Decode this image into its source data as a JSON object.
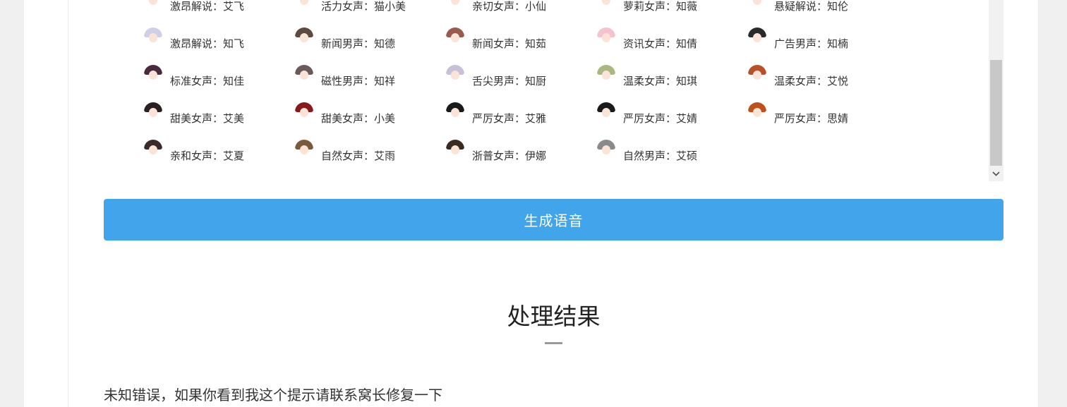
{
  "voices": [
    {
      "label": "激昂解说：艾飞",
      "icon": "avatar-icon",
      "hair": "#b8a8d8"
    },
    {
      "label": "活力女声：猫小美",
      "icon": "avatar-icon",
      "hair": "#d9b08c"
    },
    {
      "label": "亲切女声：小仙",
      "icon": "avatar-icon",
      "hair": "#e6c8e0"
    },
    {
      "label": "萝莉女声：知薇",
      "icon": "avatar-icon",
      "hair": "#6b4a3a"
    },
    {
      "label": "悬疑解说：知伦",
      "icon": "avatar-icon",
      "hair": "#1a1a1a"
    },
    {
      "label": "激昂解说：知飞",
      "icon": "avatar-icon",
      "hair": "#cfd0e8"
    },
    {
      "label": "新闻男声：知德",
      "icon": "avatar-icon",
      "hair": "#5a4a40"
    },
    {
      "label": "新闻女声：知茹",
      "icon": "avatar-icon",
      "hair": "#9a5a50"
    },
    {
      "label": "资讯女声：知倩",
      "icon": "avatar-icon",
      "hair": "#f3c4d0"
    },
    {
      "label": "广告男声：知楠",
      "icon": "avatar-icon",
      "hair": "#2a2a2a"
    },
    {
      "label": "标准女声：知佳",
      "icon": "avatar-icon",
      "hair": "#4a2a40"
    },
    {
      "label": "磁性男声：知祥",
      "icon": "avatar-icon",
      "hair": "#6a5a5a"
    },
    {
      "label": "舌尖男声：知厨",
      "icon": "avatar-icon",
      "hair": "#c8c0d8"
    },
    {
      "label": "温柔女声：知琪",
      "icon": "avatar-icon",
      "hair": "#a8b880"
    },
    {
      "label": "温柔女声：艾悦",
      "icon": "avatar-icon",
      "hair": "#b8502a"
    },
    {
      "label": "甜美女声：艾美",
      "icon": "avatar-icon",
      "hair": "#2a2020"
    },
    {
      "label": "甜美女声：小美",
      "icon": "avatar-icon",
      "hair": "#8a1a1a"
    },
    {
      "label": "严厉女声：艾雅",
      "icon": "avatar-icon",
      "hair": "#1a1a1a"
    },
    {
      "label": "严厉女声：艾婧",
      "icon": "avatar-icon",
      "hair": "#1a1a1a"
    },
    {
      "label": "严厉女声：思婧",
      "icon": "avatar-icon",
      "hair": "#c0501a"
    },
    {
      "label": "亲和女声：艾夏",
      "icon": "avatar-icon",
      "hair": "#3a2a2a"
    },
    {
      "label": "自然女声：艾雨",
      "icon": "avatar-icon",
      "hair": "#7a5a3a"
    },
    {
      "label": "浙普女声：伊娜",
      "icon": "avatar-icon",
      "hair": "#3a2a20"
    },
    {
      "label": "自然男声：艾硕",
      "icon": "avatar-icon",
      "hair": "#8a8a8a"
    }
  ],
  "generate_label": "生成语音",
  "result": {
    "title": "处理结果",
    "message": "未知错误，如果你看到我这个提示请联系窝长修复一下"
  },
  "colors": {
    "accent": "#42a5ec",
    "page_bg": "#f0f0f0"
  }
}
